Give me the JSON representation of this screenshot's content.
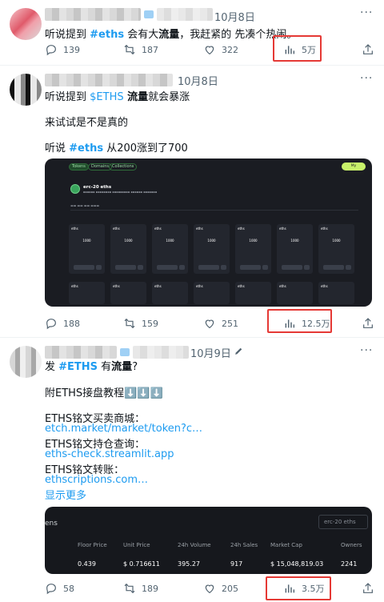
{
  "tweets": [
    {
      "date": "10月8日",
      "content": {
        "pre": "听说提到 ",
        "tag": "#eths",
        "mid": " 会有大",
        "bold": "流量",
        "post": "，我赶紧的 先凑个热闹。"
      },
      "actions": {
        "replies": "139",
        "retweets": "187",
        "likes": "322",
        "views": "5万"
      }
    },
    {
      "date": "10月8日",
      "lines": {
        "l1_pre": "听说提到 ",
        "l1_cash": "$ETHS",
        "l1_bold": " 流量",
        "l1_post": "就会暴涨",
        "l2": "来试试是不是真的",
        "l3_pre": "听说 ",
        "l3_tag": "#eths",
        "l3_post": " 从200涨到了700"
      },
      "embed": {
        "tabs": [
          "Tokens",
          "Domains",
          "Collections"
        ],
        "mint_label": "My Inscriptions",
        "token_title": "erc-20 eths",
        "tile_ticker": "eths",
        "tile_amount": "1000",
        "tile_buy": "Buy"
      },
      "actions": {
        "replies": "188",
        "retweets": "159",
        "likes": "251",
        "views": "12.5万"
      }
    },
    {
      "date": "10月9日",
      "more_dots": "·",
      "lines": {
        "l1_pre": "发 ",
        "l1_tag": "#ETHS",
        "l1_mid": " 有",
        "l1_bold": "流量",
        "l1_post": "?",
        "l2": "附ETHS接盘教程⬇️⬇️⬇️",
        "l3": "ETHS铭文买卖商城：",
        "l4": "etch.market/market/token?c…",
        "l5": "ETHS铭文持仓查询：",
        "l6": "eths-check.streamlit.app",
        "l7": "ETHS铭文转账：",
        "l8": "ethscriptions.com…",
        "l9": "显示更多"
      },
      "embed": {
        "name": "ens",
        "search_placeholder": "erc-20 eths",
        "headers": [
          "Floor Price",
          "Unit Price",
          "24h Volume",
          "24h Sales",
          "Market Cap",
          "Owners"
        ],
        "values": [
          "0.439",
          "$ 0.716611",
          "395.27",
          "917",
          "$ 15,048,819.03",
          "2241"
        ]
      },
      "actions": {
        "replies": "58",
        "retweets": "189",
        "likes": "205",
        "views": "3.5万"
      }
    }
  ],
  "icons": [
    "reply-icon",
    "retweet-icon",
    "like-icon",
    "views-icon",
    "share-icon",
    "more-icon"
  ],
  "colors": {
    "link": "#1d9bf0",
    "highlight_box": "#e53935",
    "muted": "#536471"
  }
}
